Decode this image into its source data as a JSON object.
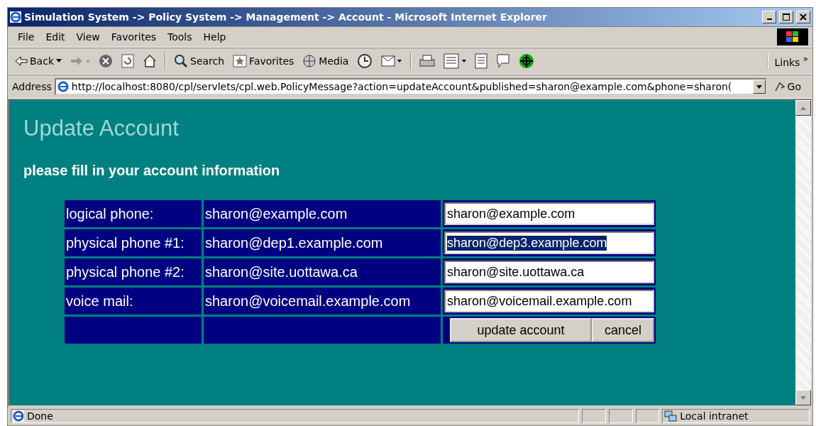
{
  "window": {
    "title": "Simulation System -> Policy System -> Management -> Account - Microsoft Internet Explorer"
  },
  "menu": [
    "File",
    "Edit",
    "View",
    "Favorites",
    "Tools",
    "Help"
  ],
  "toolbar": [
    {
      "kind": "back",
      "label": "Back"
    },
    {
      "kind": "forward"
    },
    {
      "kind": "stop"
    },
    {
      "kind": "refresh"
    },
    {
      "kind": "home"
    },
    {
      "kind": "search",
      "label": "Search"
    },
    {
      "kind": "favorites",
      "label": "Favorites"
    },
    {
      "kind": "media",
      "label": "Media"
    },
    {
      "kind": "history"
    },
    {
      "kind": "mail"
    },
    {
      "kind": "print"
    },
    {
      "kind": "edit"
    },
    {
      "kind": "discuss"
    },
    {
      "kind": "messenger"
    },
    {
      "kind": "tool"
    }
  ],
  "links": {
    "label": "Links",
    "more": "»"
  },
  "address": {
    "label": "Address",
    "url": "http://localhost:8080/cpl/servlets/cpl.web.PolicyMessage?action=updateAccount&published=sharon@example.com&phone=sharon(",
    "go": "Go"
  },
  "page": {
    "heading": "Update Account",
    "subheading": "please fill in your account information",
    "rows": [
      {
        "label": "logical phone:",
        "current": "sharon@example.com",
        "value": "sharon@example.com",
        "selected": false
      },
      {
        "label": "physical phone #1:",
        "current": "sharon@dep1.example.com",
        "value": "sharon@dep3.example.com",
        "selected": true
      },
      {
        "label": "physical phone #2:",
        "current": "sharon@site.uottawa.ca",
        "value": "sharon@site.uottawa.ca",
        "selected": false
      },
      {
        "label": "voice mail:",
        "current": "sharon@voicemail.example.com",
        "value": "sharon@voicemail.example.com",
        "selected": false
      }
    ],
    "buttons": [
      "update account",
      "cancel"
    ]
  },
  "status_bar": {
    "text": "Done",
    "zone": "Local intranet"
  }
}
